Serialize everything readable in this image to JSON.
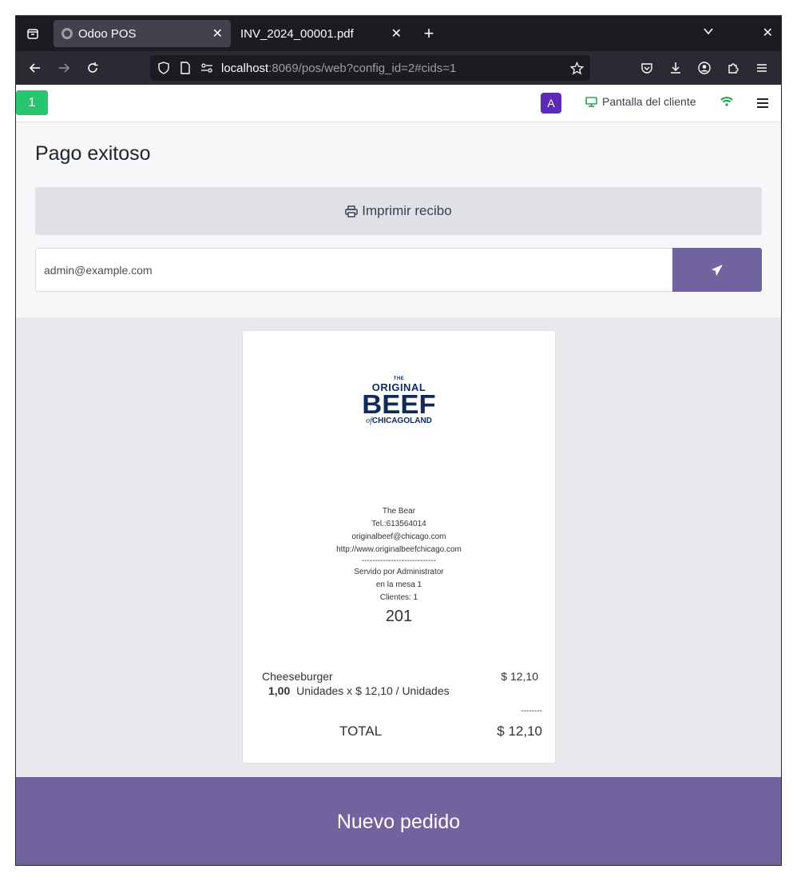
{
  "browser": {
    "tabs": [
      {
        "title": "Odoo POS",
        "active": true
      },
      {
        "title": "INV_2024_00001.pdf",
        "active": false
      }
    ],
    "url_host": "localhost",
    "url_path": ":8069/pos/web?config_id=2#cids=1"
  },
  "pos_header": {
    "order_number": "1",
    "avatar_letter": "A",
    "customer_screen_label": "Pantalla del cliente"
  },
  "payment": {
    "title": "Pago exitoso",
    "print_label": "Imprimir recibo",
    "email_value": "admin@example.com"
  },
  "receipt": {
    "logo": {
      "the": "THE",
      "original": "ORIGINAL",
      "beef": "BEEF",
      "of": "of",
      "chicagoland": "CHICAGOLAND"
    },
    "company_name": "The Bear",
    "phone": "Tel.:613564014",
    "email": "originalbeef@chicago.com",
    "website": "http://www.originalbeefchicago.com",
    "separator": "----------------------------",
    "served_by": "Servido por Administrator",
    "table": "en la mesa 1",
    "guests": "Clientes: 1",
    "order_ref": "201",
    "lines": [
      {
        "product": "Cheeseburger",
        "price": "$ 12,10",
        "qty": "1,00",
        "detail": "Unidades x $ 12,10 / Unidades"
      }
    ],
    "dashes": "--------",
    "total_label": "TOTAL",
    "total_value": "$ 12,10"
  },
  "footer": {
    "new_order_label": "Nuevo pedido"
  },
  "colors": {
    "brand": "#71639e",
    "badge_green": "#28c76f",
    "avatar": "#5b2bb6"
  }
}
